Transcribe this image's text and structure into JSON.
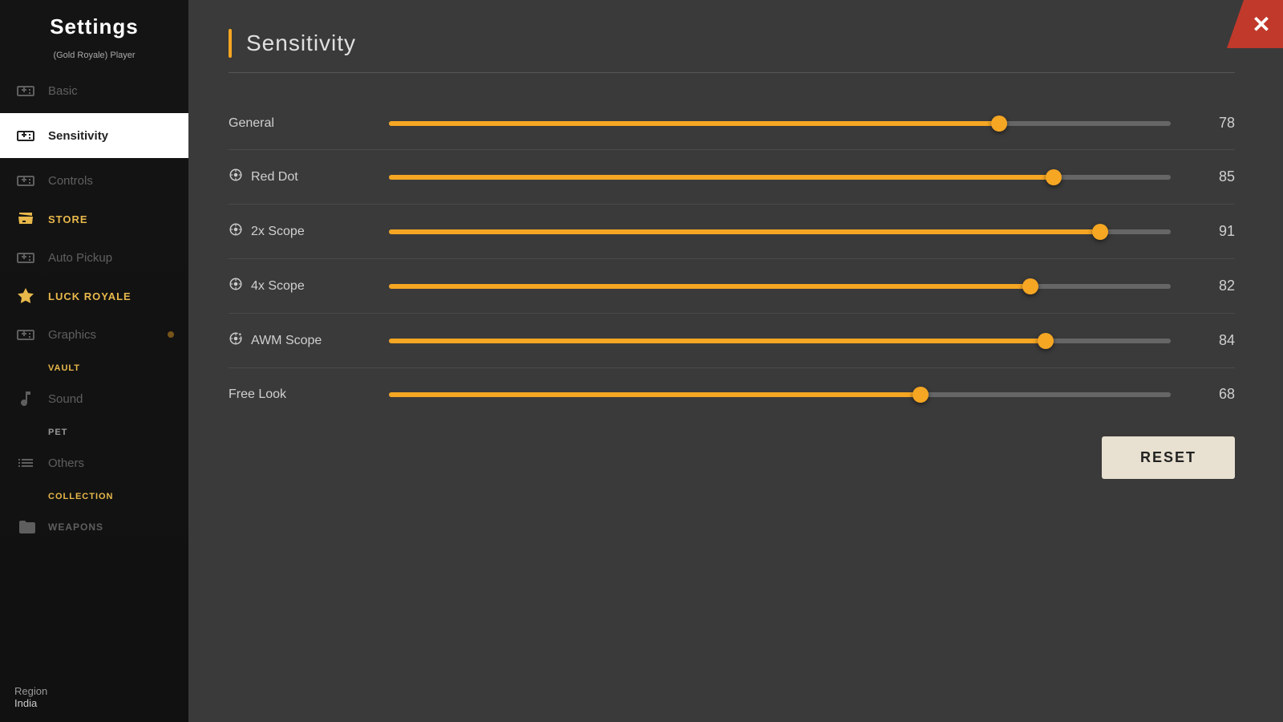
{
  "sidebar": {
    "title": "Settings",
    "player_info": "(Gold Royale) Player",
    "items": [
      {
        "id": "basic",
        "label": "Basic",
        "active": false,
        "icon": "gamepad-icon",
        "subtext": null
      },
      {
        "id": "sensitivity",
        "label": "Sensitivity",
        "active": true,
        "icon": "gamepad-icon",
        "subtext": null
      },
      {
        "id": "controls",
        "label": "Controls",
        "active": false,
        "icon": "gamepad-icon",
        "subtext": null
      },
      {
        "id": "store",
        "label": "STORE",
        "active": false,
        "icon": "store-icon",
        "subtext": null,
        "highlight": true
      },
      {
        "id": "auto-pickup",
        "label": "Auto Pickup",
        "active": false,
        "icon": "gamepad-icon",
        "subtext": null
      },
      {
        "id": "luck-royale",
        "label": "LUCK ROYALE",
        "active": false,
        "icon": "luck-icon",
        "subtext": null,
        "highlight": true
      },
      {
        "id": "graphics",
        "label": "Graphics",
        "active": false,
        "icon": "gamepad-icon",
        "subtext": null,
        "badge": true
      },
      {
        "id": "vault",
        "label": "VAULT",
        "active": false,
        "subtext": true
      },
      {
        "id": "sound",
        "label": "Sound",
        "active": false,
        "icon": "music-icon",
        "subtext": null
      },
      {
        "id": "pet",
        "label": "PET",
        "active": false,
        "subtext": null
      },
      {
        "id": "others",
        "label": "Others",
        "active": false,
        "icon": "list-icon",
        "subtext": null
      },
      {
        "id": "collection",
        "label": "COLLECTION",
        "active": false
      },
      {
        "id": "weapons",
        "label": "WEAPONS",
        "active": false
      }
    ],
    "region_label": "Region",
    "region_value": "India"
  },
  "main": {
    "close_label": "✕",
    "section_title": "Sensitivity",
    "sliders": [
      {
        "id": "general",
        "label": "General",
        "icon": null,
        "value": 78,
        "percent": 78
      },
      {
        "id": "red-dot",
        "label": "Red Dot",
        "icon": "scope",
        "value": 85,
        "percent": 85
      },
      {
        "id": "2x-scope",
        "label": "2x Scope",
        "icon": "scope",
        "value": 91,
        "percent": 91
      },
      {
        "id": "4x-scope",
        "label": "4x Scope",
        "icon": "scope",
        "value": 82,
        "percent": 82
      },
      {
        "id": "awm-scope",
        "label": "AWM Scope",
        "icon": "scope-plus",
        "value": 84,
        "percent": 84
      },
      {
        "id": "free-look",
        "label": "Free Look",
        "icon": null,
        "value": 68,
        "percent": 68
      }
    ],
    "reset_label": "RESET"
  }
}
